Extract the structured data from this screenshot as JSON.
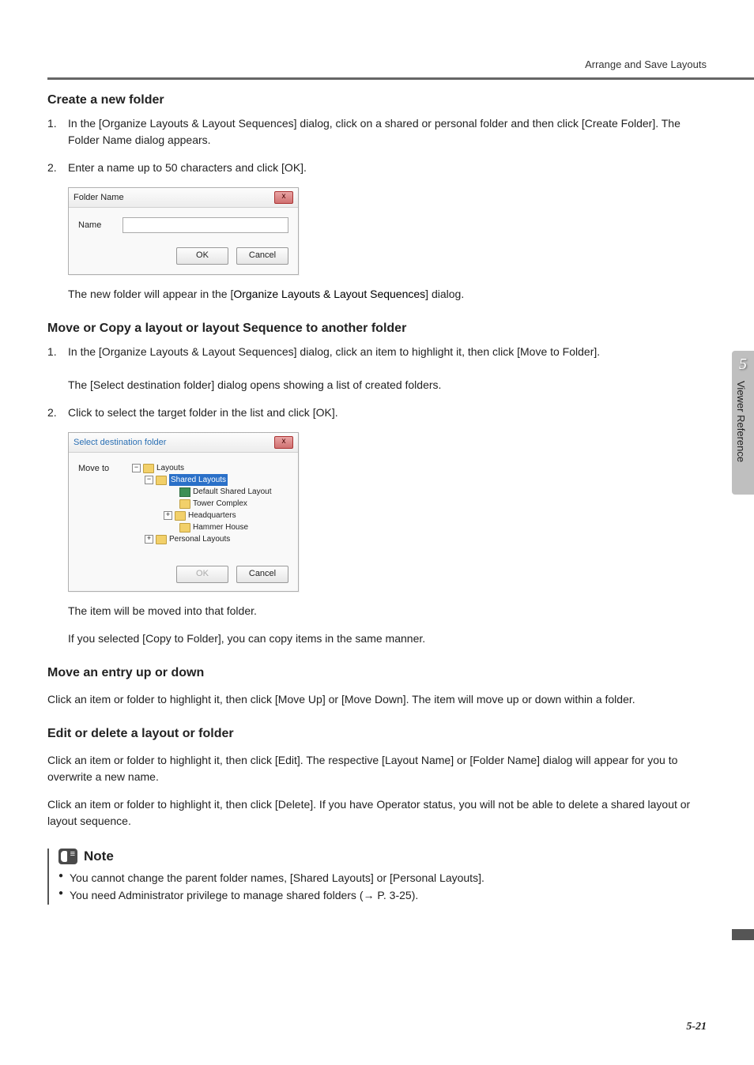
{
  "header": {
    "breadcrumb": "Arrange and Save Layouts"
  },
  "sidetab": {
    "chapter": "5",
    "label": "Viewer Reference"
  },
  "section1": {
    "title": "Create a new folder",
    "step1_num": "1.",
    "step1": "In the [Organize Layouts & Layout Sequences] dialog, click on a shared or personal folder and then click [Create Folder]. The Folder Name dialog appears.",
    "step2_num": "2.",
    "step2": "Enter a name up to 50 characters and click [OK].",
    "after_pre": "The new folder will appear in the [",
    "after_bold": "Organize Layouts & Layout Sequences",
    "after_post": "] dialog."
  },
  "dlg1": {
    "title": "Folder Name",
    "close": "x",
    "name_label": "Name",
    "ok": "OK",
    "cancel": "Cancel"
  },
  "section2": {
    "title": "Move or Copy a layout or layout Sequence to another folder",
    "step1_num": "1.",
    "step1": "In the [Organize Layouts & Layout Sequences] dialog, click an item to highlight it, then click [Move to Folder].",
    "step1_after_pre": "The [",
    "step1_after_bold": "Select destination folder",
    "step1_after_post": "] dialog opens showing a list of created folders.",
    "step2_num": "2.",
    "step2": "Click to select the target folder in the list and click [OK].",
    "after1": "The item will be moved into that folder.",
    "after2_pre": "If you selected [",
    "after2_bold": "Copy to Folder",
    "after2_post": "], you can copy items in the same manner."
  },
  "dlg2": {
    "title": "Select destination folder",
    "close": "x",
    "move_to": "Move to",
    "tree": {
      "root": "Layouts",
      "shared": "Shared Layouts",
      "default": "Default Shared Layout",
      "tower": "Tower Complex",
      "hq": "Headquarters",
      "hammer": "Hammer House",
      "personal": "Personal Layouts",
      "minus": "−",
      "plus": "+"
    },
    "ok": "OK",
    "cancel": "Cancel"
  },
  "section3": {
    "title": "Move an entry up or down",
    "body_pre": "Click an item or folder to highlight it, then click [",
    "body_b1": "Move Up",
    "body_mid": "] or [",
    "body_b2": "Move Down",
    "body_post": "]. The item will move up or down within a folder."
  },
  "section4": {
    "title": "Edit or delete a layout or folder",
    "p1_pre": "Click an item or folder to highlight it, then click [",
    "p1_b1": "Edit",
    "p1_mid1": "]. The respective [",
    "p1_b2": "Layout Name",
    "p1_mid2": "] or [",
    "p1_b3": "Folder Name",
    "p1_post": "] dialog will appear for you to overwrite a new name.",
    "p2_pre": "Click an item or folder to highlight it, then click [",
    "p2_b1": "Delete",
    "p2_post": "]. If you have Operator status, you will not be able to delete a shared layout or layout sequence."
  },
  "note": {
    "title": "Note",
    "li1_pre": "You cannot change the parent folder names, [",
    "li1_b1": "Shared Layouts",
    "li1_mid": "] or [",
    "li1_b2": "Personal Layouts",
    "li1_post": "].",
    "li2": "You need Administrator privilege to manage shared folders (→ P. 3-25)."
  },
  "footer": {
    "page": "5-21"
  }
}
